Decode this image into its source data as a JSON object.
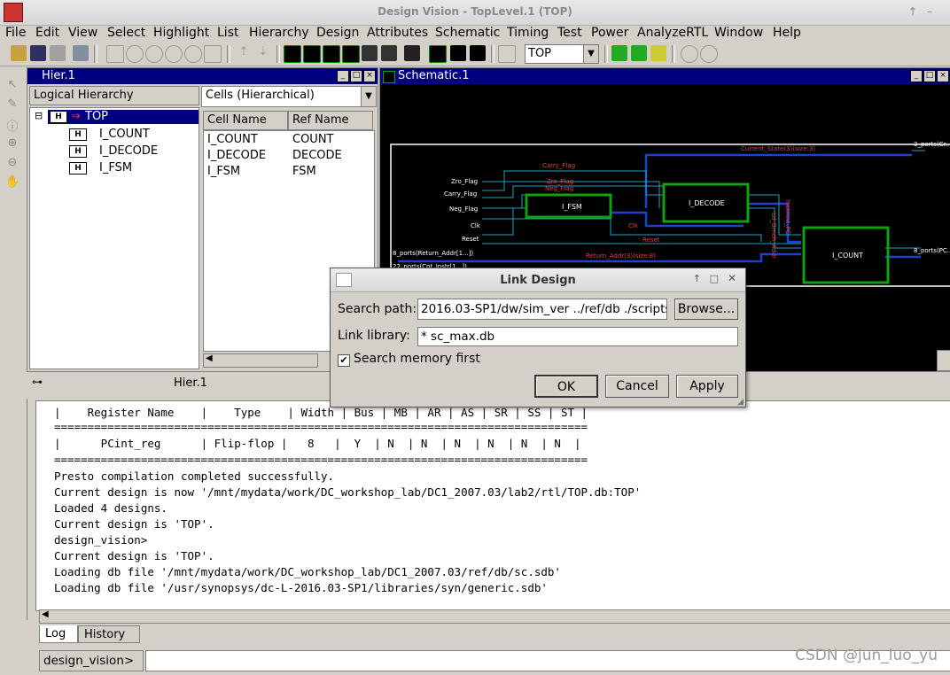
{
  "window": {
    "title": "Design Vision - TopLevel.1 (TOP)"
  },
  "menubar": {
    "items": [
      "File",
      "Edit",
      "View",
      "Select",
      "Highlight",
      "List",
      "Hierarchy",
      "Design",
      "Attributes",
      "Schematic",
      "Timing",
      "Test",
      "Power",
      "AnalyzeRTL",
      "Window",
      "Help"
    ]
  },
  "toolbar": {
    "design_combo": "TOP"
  },
  "hier_panel": {
    "title": "Hier.1",
    "tree_header": "Logical Hierarchy",
    "cells_dropdown": "Cells (Hierarchical)",
    "tree": [
      {
        "badge": "H",
        "label": "TOP",
        "selected": true
      },
      {
        "badge": "H",
        "label": "I_COUNT"
      },
      {
        "badge": "H",
        "label": "I_DECODE"
      },
      {
        "badge": "H",
        "label": "I_FSM"
      }
    ],
    "columns": [
      "Cell Name",
      "Ref Name"
    ],
    "rows": [
      [
        "I_COUNT",
        "COUNT"
      ],
      [
        "I_DECODE",
        "DECODE"
      ],
      [
        "I_FSM",
        "FSM"
      ]
    ]
  },
  "schematic": {
    "title": "Schematic.1",
    "blocks": [
      "I_FSM",
      "I_DECODE",
      "I_COUNT"
    ],
    "ports_in": [
      "Zro_Flag",
      "Carry_Flag",
      "Neg_Flag",
      "Clk",
      "Reset",
      "8_ports(Return_Addr[1...])",
      "22_ports(Cnt_Instr[1...])"
    ],
    "nets": [
      "Carry_Flag",
      "Zro_Flag",
      "Neg_Flag",
      "Clk",
      "Reset",
      "Return_Addr(3)(size:8)",
      "Current_State(3)(size:3)",
      "Incrmnt_PC",
      "Ld_Brnch_Addr"
    ],
    "ports_out": [
      "3_ports(Cr...",
      "8_ports(PC..."
    ]
  },
  "lower_panel": {
    "title": "Hier.1"
  },
  "log": {
    "lines": [
      "|    Register Name    |    Type    | Width | Bus | MB | AR | AS | SR | SS | ST |",
      "================================================================================",
      "|      PCint_reg      | Flip-flop |   8   |  Y  | N  | N  | N  | N  | N  | N  |",
      "================================================================================",
      "Presto compilation completed successfully.",
      "Current design is now '/mnt/mydata/work/DC_workshop_lab/DC1_2007.03/lab2/rtl/TOP.db:TOP'",
      "Loaded 4 designs.",
      "Current design is 'TOP'.",
      "design_vision>",
      "Current design is 'TOP'.",
      "Loading db file '/mnt/mydata/work/DC_workshop_lab/DC1_2007.03/ref/db/sc.sdb'",
      "Loading db file '/usr/synopsys/dc-L-2016.03-SP1/libraries/syn/generic.sdb'"
    ]
  },
  "tabs": [
    "Log",
    "History"
  ],
  "command": {
    "prompt": "design_vision>"
  },
  "dialog": {
    "title": "Link Design",
    "search_path_label": "Search path:",
    "search_path_value": "2016.03-SP1/dw/sim_ver ../ref/db ./scripts",
    "browse_label": "Browse...",
    "link_library_label": "Link library:",
    "link_library_value": "* sc_max.db",
    "checkbox_label": "Search memory first",
    "checkbox_checked": true,
    "ok_label": "OK",
    "cancel_label": "Cancel",
    "apply_label": "Apply"
  },
  "watermark": "CSDN @jun_luo_yu"
}
